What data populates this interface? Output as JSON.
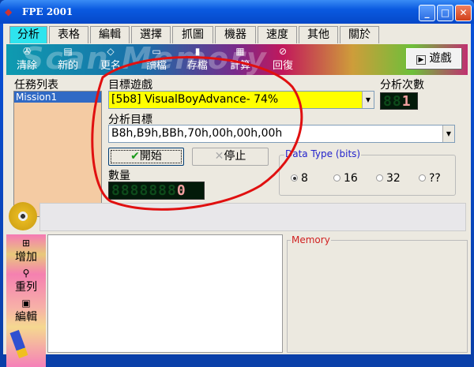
{
  "window": {
    "title": "FPE  2001",
    "minimize": "_",
    "maximize": "□",
    "close": "✕"
  },
  "tabs": [
    {
      "label": "分析"
    },
    {
      "label": "表格"
    },
    {
      "label": "編輯"
    },
    {
      "label": "選擇"
    },
    {
      "label": "抓圖"
    },
    {
      "label": "機器"
    },
    {
      "label": "速度"
    },
    {
      "label": "其他"
    },
    {
      "label": "關於"
    }
  ],
  "toolbar": {
    "watermark": "Scan Memory",
    "items": [
      {
        "label": "清除",
        "icon": "clear-icon"
      },
      {
        "label": "新的",
        "icon": "new-icon"
      },
      {
        "label": "更名",
        "icon": "rename-icon"
      },
      {
        "label": "讀檔",
        "icon": "open-folder-icon"
      },
      {
        "label": "存檔",
        "icon": "save-disk-icon"
      },
      {
        "label": "計算",
        "icon": "calculator-icon"
      },
      {
        "label": "回復",
        "icon": "undo-icon"
      }
    ],
    "game_button": "遊戲"
  },
  "tasks": {
    "label": "任務列表",
    "items": [
      "Mission1"
    ]
  },
  "target_game": {
    "label": "目標遊戲",
    "value": "[5b8] VisualBoyAdvance- 74%"
  },
  "analysis_count": {
    "label": "分析次數",
    "led": "88",
    "digit": "1"
  },
  "analysis_target": {
    "label": "分析目標",
    "value": "B8h,B9h,BBh,70h,00h,00h,00h"
  },
  "buttons": {
    "start": "開始",
    "stop": "停止"
  },
  "quantity": {
    "label": "數量",
    "led": "8888888",
    "digit": "0"
  },
  "data_type": {
    "label": "Data Type (bits)",
    "options": [
      "8",
      "16",
      "32",
      "??"
    ],
    "selected": "8"
  },
  "side_tools": [
    {
      "label": "增加"
    },
    {
      "label": "重列"
    },
    {
      "label": "編輯"
    }
  ],
  "memory": {
    "label": "Memory"
  }
}
